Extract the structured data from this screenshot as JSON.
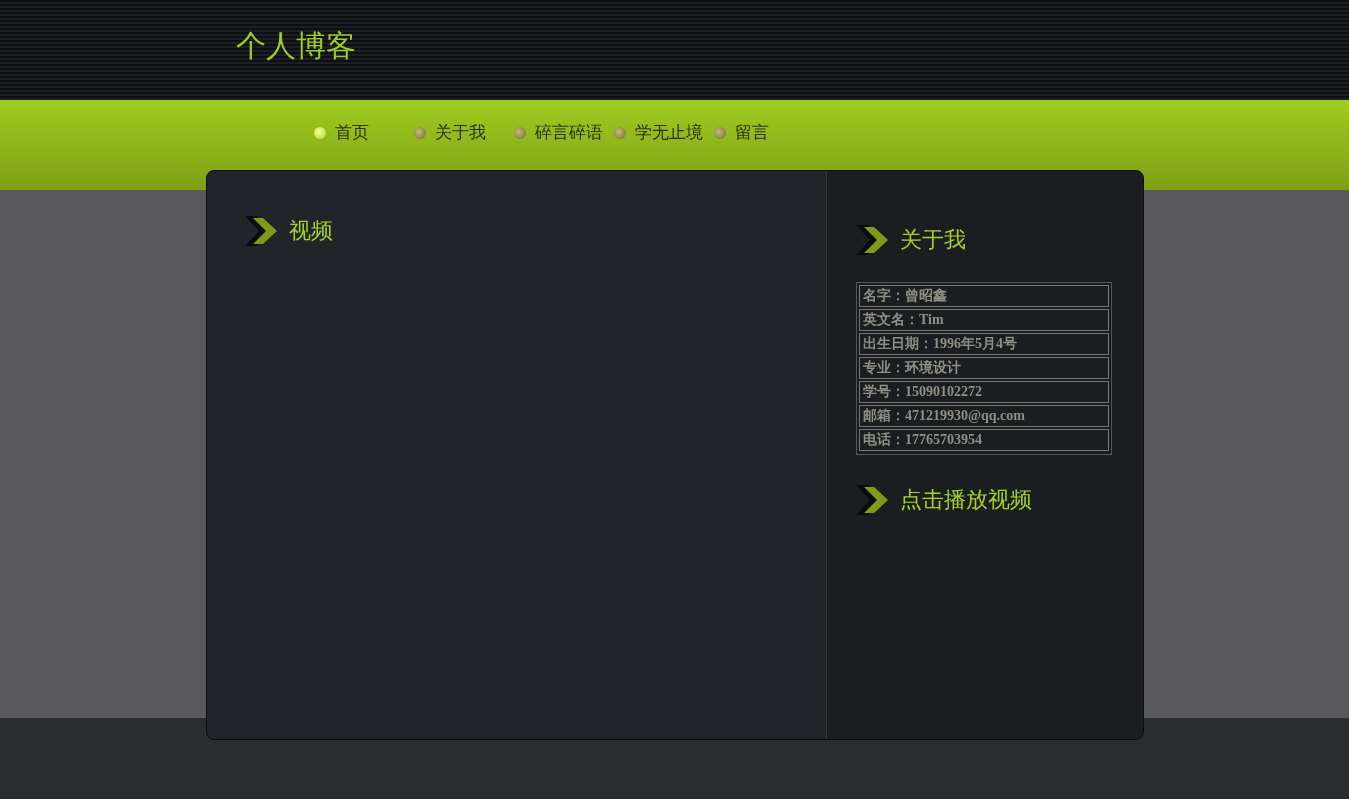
{
  "site_title": "个人博客",
  "nav": [
    {
      "label": "首页",
      "selected": true
    },
    {
      "label": "关于我",
      "selected": false
    },
    {
      "label": "碎言碎语",
      "selected": false
    },
    {
      "label": "学无止境",
      "selected": false
    },
    {
      "label": "留言",
      "selected": false
    }
  ],
  "main": {
    "heading": "视频"
  },
  "sidebar": {
    "about_heading": "关于我",
    "profile": [
      {
        "label": "名字：",
        "value": "曾昭鑫"
      },
      {
        "label": "英文名：",
        "value": "Tim"
      },
      {
        "label": "出生日期：",
        "value": "1996年5月4号"
      },
      {
        "label": "专业：",
        "value": "环境设计"
      },
      {
        "label": "学号：",
        "value": "15090102272"
      },
      {
        "label": "邮箱：",
        "value": "471219930@qq.com"
      },
      {
        "label": "电话：",
        "value": "17765703954"
      }
    ],
    "video_heading": "点击播放视频"
  }
}
